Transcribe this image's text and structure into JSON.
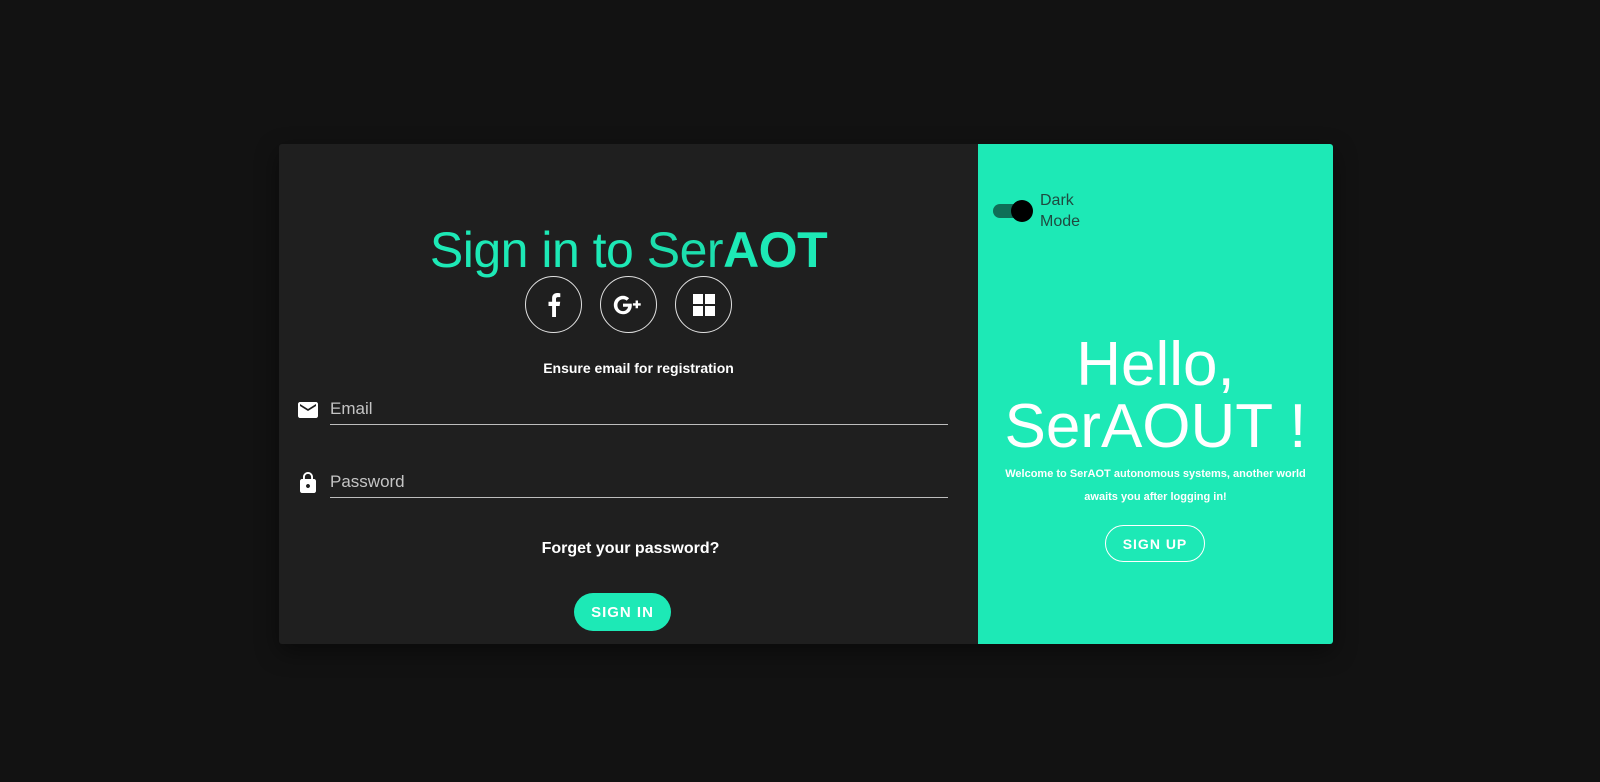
{
  "login": {
    "title_prefix": "Sign in to ",
    "title_brand_light": "Ser",
    "title_brand_bold": "AOT",
    "social": [
      {
        "icon": "facebook-icon"
      },
      {
        "icon": "google-plus-icon"
      },
      {
        "icon": "windows-icon"
      }
    ],
    "helper_text": "Ensure email for registration",
    "email_placeholder": "Email",
    "password_placeholder": "Password",
    "forgot_text": "Forget your password?",
    "signin_label": "SIGN IN"
  },
  "panel": {
    "dark_mode_label": "Dark Mode",
    "dark_mode_on": true,
    "hello_line1": "Hello,",
    "hello_line2": "SerAOUT !",
    "welcome_text": "Welcome to SerAOT autonomous systems, another world awaits you after logging in!",
    "signup_label": "SIGN UP"
  },
  "colors": {
    "accent": "#1de9b6",
    "page_bg": "#121212",
    "card_bg": "#1f1f1f"
  }
}
